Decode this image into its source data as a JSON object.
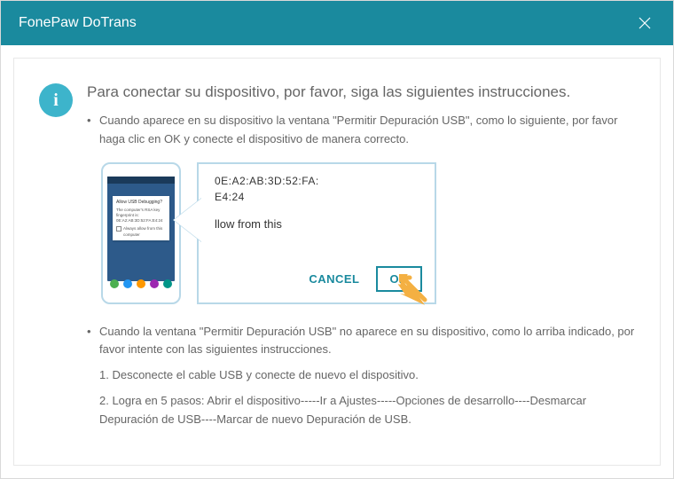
{
  "window": {
    "title": "FonePaw DoTrans"
  },
  "info_icon_label": "i",
  "heading": "Para conectar su dispositivo, por favor, siga las siguientes instrucciones.",
  "bullet1": "Cuando aparece en su dispositivo la ventana \"Permitir Depuración USB\", como lo siguiente, por favor haga clic en OK y conecte el dispositivo de manera correcto.",
  "bullet2": "Cuando la ventana \"Permitir Depuración USB\" no aparece en su dispositivo, como lo arriba indicado, por favor intente con las siguientes instrucciones.",
  "step1": "1. Desconecte el cable USB y conecte de nuevo el dispositivo.",
  "step2": "2. Logra en 5 pasos: Abrir el dispositivo-----Ir a Ajustes-----Opciones de desarrollo----Desmarcar Depuración de USB----Marcar de nuevo Depuración de USB.",
  "illustration": {
    "phone_dialog_title": "Allow USB Debugging?",
    "phone_dialog_body": "The computer's RSA key fingerprint is:",
    "phone_dialog_mac": "0E:A2:AB:3D:52:FA:E4:24",
    "phone_dialog_check": "Always allow from this computer",
    "panel_mac_line1": "0E:A2:AB:3D:52:FA:",
    "panel_mac_line2": "E4:24",
    "panel_allow_text": "llow from this",
    "cancel_label": "CANCEL",
    "ok_label": "OK"
  },
  "colors": {
    "titlebar": "#1a8a9e",
    "info_icon": "#3db4cb",
    "panel_border": "#b8d8e8",
    "dock_green": "#4caf50",
    "dock_blue": "#2196f3",
    "dock_orange": "#ff9800",
    "dock_purple": "#9c27b0",
    "dock_teal": "#009688",
    "arrow": "#f4b042"
  }
}
